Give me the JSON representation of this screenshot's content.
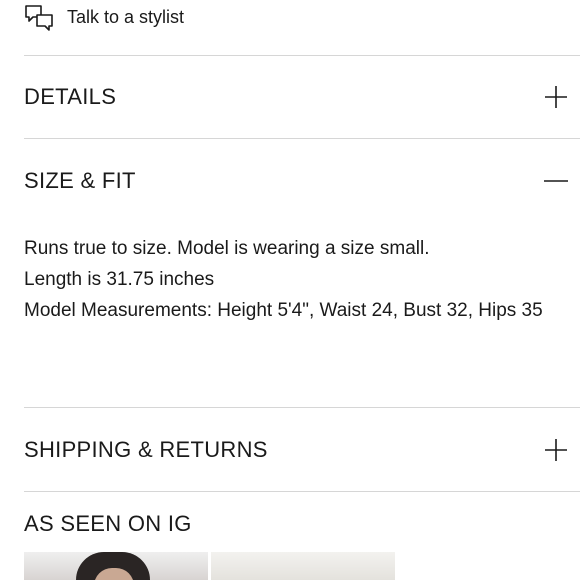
{
  "stylist": {
    "label": "Talk to a stylist",
    "icon": "chat-bubbles-icon"
  },
  "accordions": [
    {
      "title": "DETAILS",
      "state": "collapsed",
      "icon": "plus-icon"
    },
    {
      "title": "SIZE & FIT",
      "state": "expanded",
      "icon": "minus-icon"
    },
    {
      "title": "SHIPPING & RETURNS",
      "state": "collapsed",
      "icon": "plus-icon"
    }
  ],
  "size_fit": {
    "lines": [
      "Runs true to size. Model is wearing a size small.",
      "Length is 31.75 inches",
      "Model Measurements: Height 5'4\", Waist 24, Bust 32, Hips 35"
    ]
  },
  "instagram": {
    "title": "AS SEEN ON IG"
  }
}
